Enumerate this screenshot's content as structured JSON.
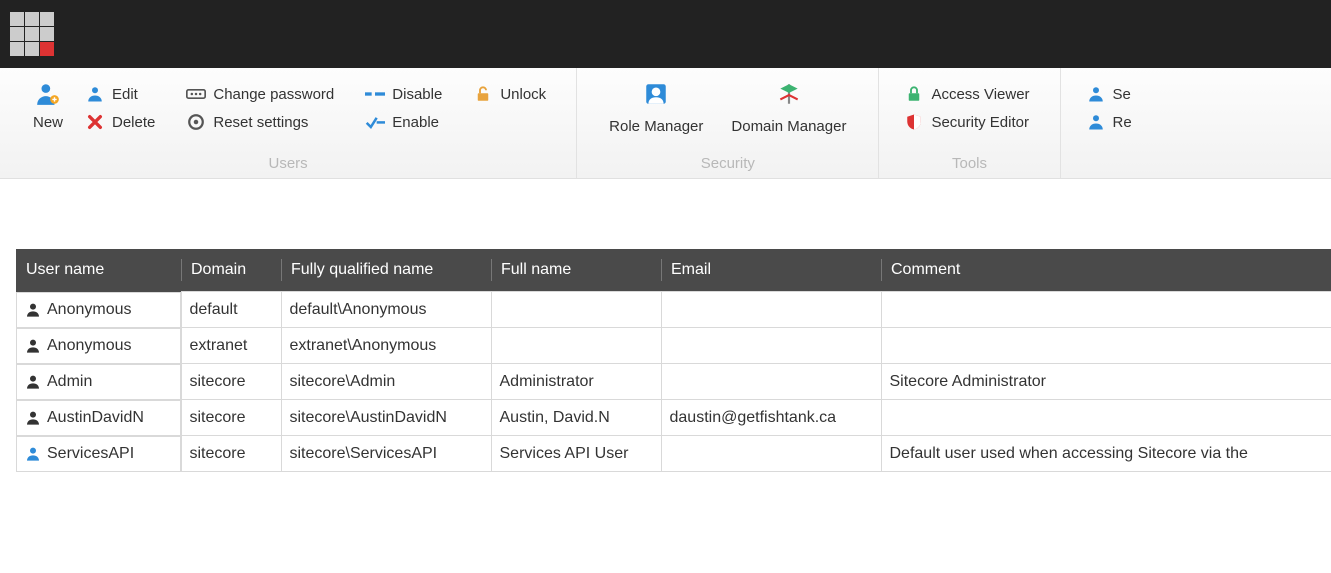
{
  "ribbon": {
    "users_group_label": "Users",
    "security_group_label": "Security",
    "tools_group_label": "Tools",
    "new": "New",
    "edit": "Edit",
    "delete": "Delete",
    "change_password": "Change password",
    "reset_settings": "Reset settings",
    "disable": "Disable",
    "enable": "Enable",
    "unlock": "Unlock",
    "role_manager": "Role Manager",
    "domain_manager": "Domain Manager",
    "access_viewer": "Access Viewer",
    "security_editor": "Security Editor",
    "se": "Se",
    "re": "Re"
  },
  "table": {
    "headers": {
      "user_name": "User name",
      "domain": "Domain",
      "fqn": "Fully qualified name",
      "full_name": "Full name",
      "email": "Email",
      "comment": "Comment"
    },
    "rows": [
      {
        "icon": "dark",
        "user": "Anonymous",
        "domain": "default",
        "fqn": "default\\Anonymous",
        "full": "",
        "email": "",
        "comment": ""
      },
      {
        "icon": "dark",
        "user": "Anonymous",
        "domain": "extranet",
        "fqn": "extranet\\Anonymous",
        "full": "",
        "email": "",
        "comment": ""
      },
      {
        "icon": "dark",
        "user": "Admin",
        "domain": "sitecore",
        "fqn": "sitecore\\Admin",
        "full": "Administrator",
        "email": "",
        "comment": "Sitecore Administrator"
      },
      {
        "icon": "dark",
        "user": "AustinDavidN",
        "domain": "sitecore",
        "fqn": "sitecore\\AustinDavidN",
        "full": "Austin, David.N",
        "email": "daustin@getfishtank.ca",
        "comment": ""
      },
      {
        "icon": "blue",
        "user": "ServicesAPI",
        "domain": "sitecore",
        "fqn": "sitecore\\ServicesAPI",
        "full": "Services API User",
        "email": "",
        "comment": "Default user used when accessing Sitecore via the "
      }
    ]
  }
}
